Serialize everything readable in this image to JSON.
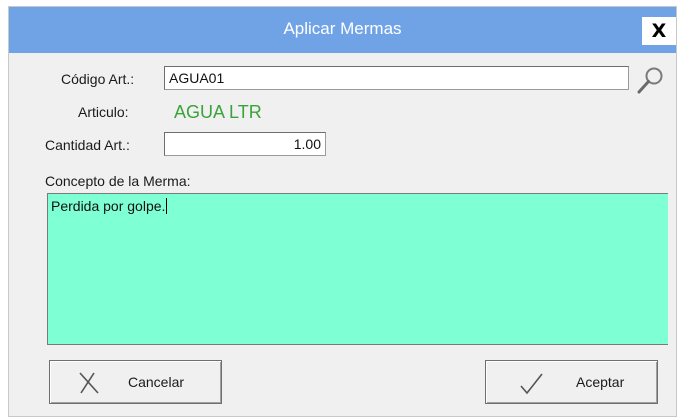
{
  "window": {
    "title": "Aplicar Mermas",
    "close_label": "X"
  },
  "form": {
    "codigo_label": "Código Art.:",
    "codigo_value": "AGUA01",
    "articulo_label": "Articulo:",
    "articulo_value": "AGUA LTR",
    "cantidad_label": "Cantidad Art.:",
    "cantidad_value": "1.00",
    "concepto_label": "Concepto  de la Merma:",
    "concepto_value": "Perdida por golpe."
  },
  "buttons": {
    "cancel_label": "Cancelar",
    "accept_label": "Aceptar"
  },
  "icons": {
    "search": "magnifier-icon",
    "cancel": "x-mark-icon",
    "accept": "checkmark-icon"
  },
  "colors": {
    "titlebar": "#6fa3e6",
    "articulo_text": "#3aa33a",
    "concepto_bg": "#7fffd4"
  }
}
